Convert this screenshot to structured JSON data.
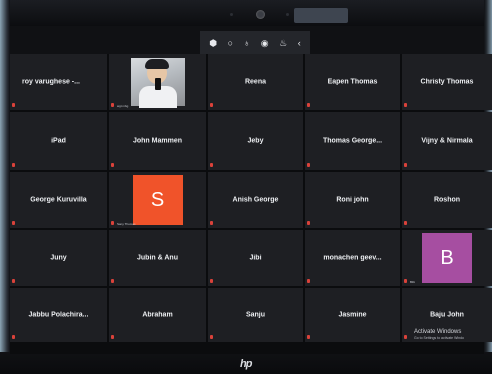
{
  "device": {
    "notification_text": "",
    "brand": "hp"
  },
  "toolbar": {
    "items": [
      {
        "name": "hp-logo-icon",
        "glyph": "⬢"
      },
      {
        "name": "record-icon",
        "glyph": "○"
      },
      {
        "name": "microphone-icon",
        "glyph": "♁"
      },
      {
        "name": "camera-icon",
        "glyph": "◉"
      },
      {
        "name": "raise-hand-icon",
        "glyph": "♨"
      },
      {
        "name": "chevron-left-icon",
        "glyph": "‹"
      }
    ]
  },
  "participants": [
    {
      "name": "roy varughese -...",
      "align": "left"
    },
    {
      "name": "",
      "video": true,
      "tag": "wgt mbg"
    },
    {
      "name": "Reena"
    },
    {
      "name": "Eapen Thomas"
    },
    {
      "name": "Christy Thomas"
    },
    {
      "name": "iPad"
    },
    {
      "name": "John Mammen"
    },
    {
      "name": "Jeby"
    },
    {
      "name": "Thomas George..."
    },
    {
      "name": "Vijny & Nirmala"
    },
    {
      "name": "George Kuruvilla"
    },
    {
      "name": "",
      "avatar": "S",
      "avatar_color": "#f0532a",
      "tag": "Sany Thomas"
    },
    {
      "name": "Anish George"
    },
    {
      "name": "Roni john"
    },
    {
      "name": "Roshon"
    },
    {
      "name": "Juny"
    },
    {
      "name": "Jubin & Anu"
    },
    {
      "name": "Jibi"
    },
    {
      "name": "monachen geev..."
    },
    {
      "name": "",
      "avatar": "B",
      "avatar_color": "#a64ea1",
      "tag": "Bibi"
    },
    {
      "name": "Jabbu Polachira..."
    },
    {
      "name": "Abraham"
    },
    {
      "name": "Sanju"
    },
    {
      "name": "Jasmine"
    },
    {
      "name": "Baju John"
    }
  ],
  "activation": {
    "title": "Activate Windows",
    "subtitle": "Go to Settings to activate Windo"
  }
}
